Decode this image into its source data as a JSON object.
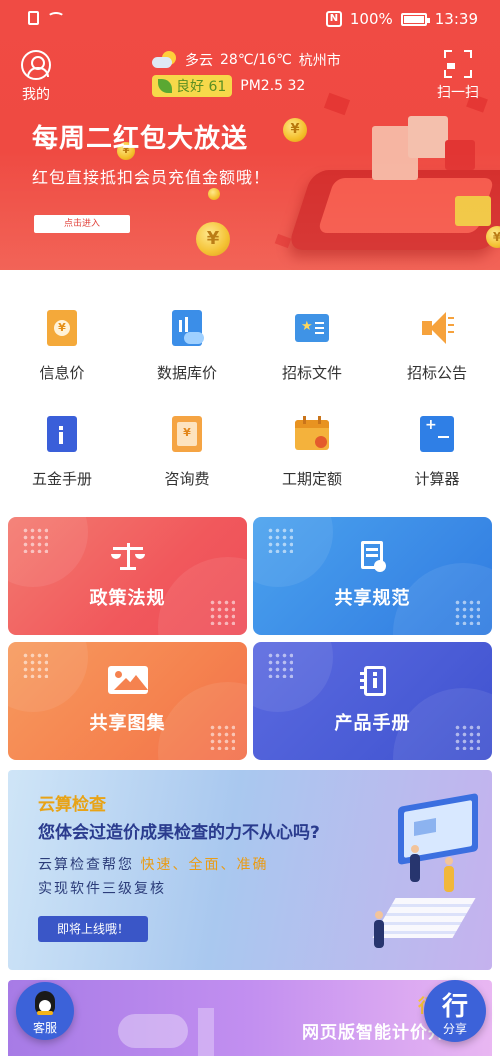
{
  "status_bar": {
    "battery_percent": "100%",
    "time": "13:39"
  },
  "header": {
    "mine_label": "我的",
    "weather": {
      "condition": "多云",
      "temperature": "28℃/16℃",
      "city": "杭州市"
    },
    "air": {
      "quality": "良好 61",
      "pm25": "PM2.5 32"
    },
    "scan_label": "扫一扫"
  },
  "banner": {
    "title": "每周二红包大放送",
    "subtitle": "红包直接抵扣会员充值金额哦！",
    "button": "点击进入"
  },
  "grid": [
    {
      "label": "信息价",
      "icon": "info-price-icon",
      "color": "#f4a93a"
    },
    {
      "label": "数据库价",
      "icon": "database-price-icon",
      "color": "#3b8ee8"
    },
    {
      "label": "招标文件",
      "icon": "tender-document-icon",
      "color": "#3f93e6"
    },
    {
      "label": "招标公告",
      "icon": "announcement-speaker-icon",
      "color": "#f6a23c"
    },
    {
      "label": "五金手册",
      "icon": "hardware-manual-icon",
      "color": "#3a5fd9"
    },
    {
      "label": "咨询费",
      "icon": "consulting-fee-icon",
      "color": "#f5a443"
    },
    {
      "label": "工期定额",
      "icon": "calendar-icon",
      "color": "#f4b23c"
    },
    {
      "label": "计算器",
      "icon": "calculator-icon",
      "color": "#2f7fe6"
    }
  ],
  "cards": [
    {
      "label": "政策法规",
      "icon": "scales-icon"
    },
    {
      "label": "共享规范",
      "icon": "document-badge-icon"
    },
    {
      "label": "共享图集",
      "icon": "picture-icon"
    },
    {
      "label": "产品手册",
      "icon": "notebook-icon"
    }
  ],
  "cloud_check": {
    "title": "云算检查",
    "question": "您体会过造价成果检查的力不从心吗?",
    "line1_prefix": "云算检查帮您",
    "line1_highlight": "快速、全面、准确",
    "line2": "实现软件三级复核",
    "button": "即将上线哦！"
  },
  "bottom_promo": {
    "brand": "行行云",
    "text": "网页版智能计价开创"
  },
  "floating": {
    "service_label": "客服",
    "share_char": "行",
    "share_label": "分享"
  },
  "colors": {
    "banner_red": "#ef4a42",
    "card_policy": "#f15f61",
    "card_share_spec": "#3a8ee9",
    "card_atlas": "#f58a55",
    "card_manual": "#4a5cd6"
  }
}
